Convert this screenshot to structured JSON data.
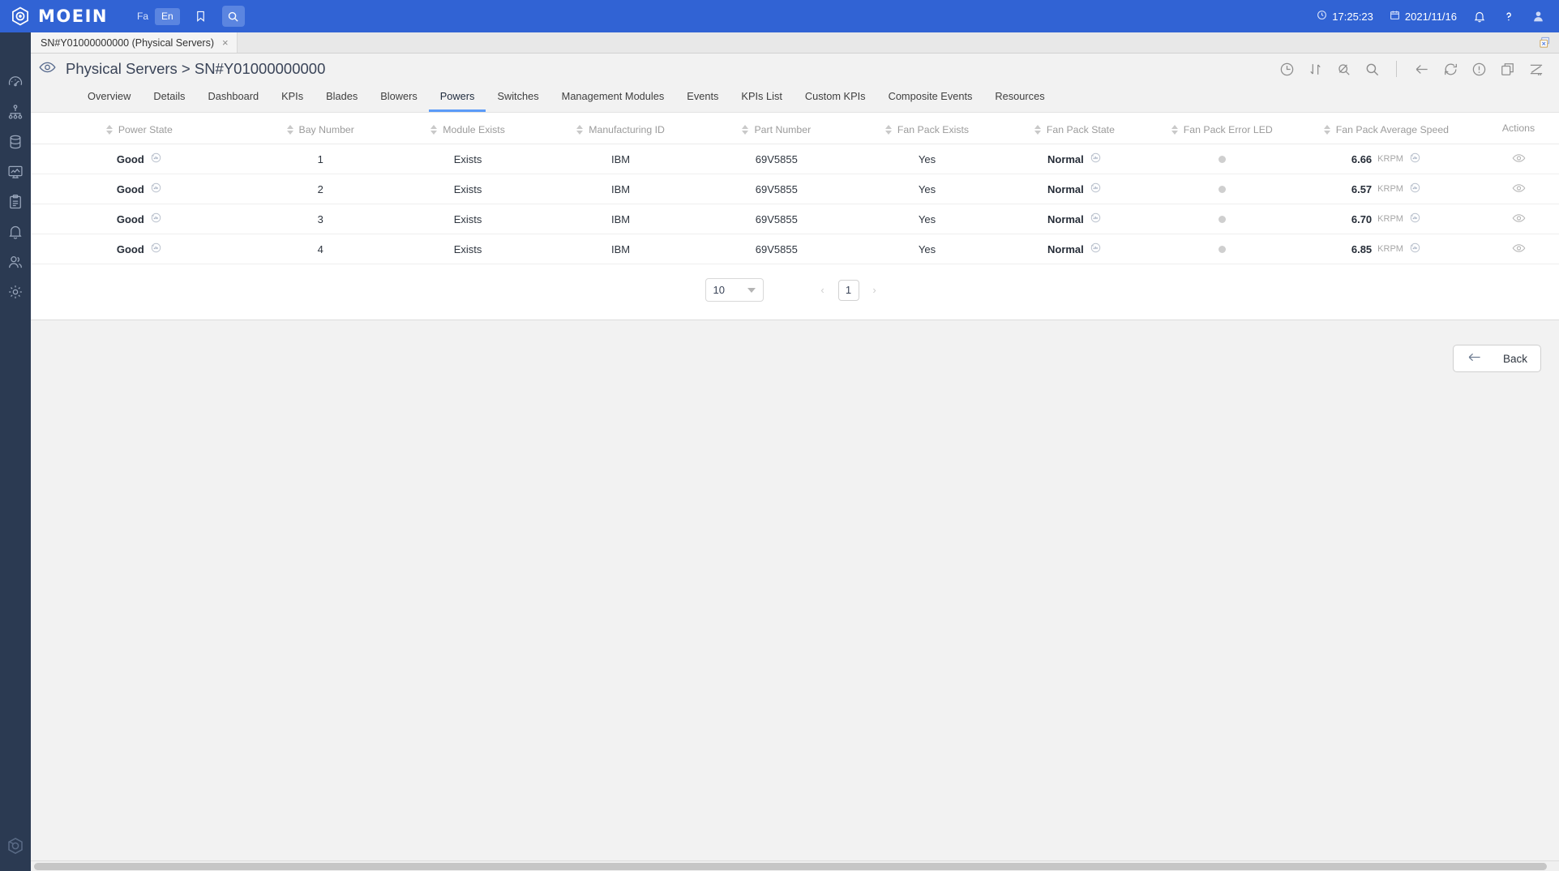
{
  "brand": {
    "name": "MOEIN",
    "logo_icon": "moein-logo-icon"
  },
  "header": {
    "lang_fa": "Fa",
    "lang_en": "En",
    "lang_active": "En",
    "bookmark_icon": "bookmark-icon",
    "search_icon": "search-icon",
    "time": "17:25:23",
    "date": "2021/11/16",
    "clock_icon": "clock-icon",
    "calendar_icon": "calendar-icon",
    "notifications_icon": "bell-icon",
    "help_icon": "question-mark-icon",
    "user_icon": "user-avatar-icon"
  },
  "tabstrip": {
    "tabs": [
      {
        "label": "SN#Y01000000000 (Physical Servers)",
        "close_glyph": "×",
        "active": true
      }
    ],
    "close_all_icon": "close-all-tabs-icon"
  },
  "sidebar": {
    "items": [
      {
        "name": "sidebar-item-monitoring",
        "icon": "gauge-icon"
      },
      {
        "name": "sidebar-item-topology",
        "icon": "hierarchy-icon"
      },
      {
        "name": "sidebar-item-inventory",
        "icon": "database-icon"
      },
      {
        "name": "sidebar-item-dashboards",
        "icon": "dashboard-chart-icon"
      },
      {
        "name": "sidebar-item-reports",
        "icon": "clipboard-icon"
      },
      {
        "name": "sidebar-item-alerts",
        "icon": "bell-icon"
      },
      {
        "name": "sidebar-item-users",
        "icon": "users-icon"
      },
      {
        "name": "sidebar-item-settings",
        "icon": "gear-icon"
      }
    ],
    "bottom_item": {
      "name": "sidebar-item-brand",
      "icon": "moein-mark-icon"
    }
  },
  "page": {
    "breadcrumb_icon": "eye-icon",
    "title": "Physical Servers > SN#Y01000000000",
    "tools": [
      {
        "name": "history-tool",
        "icon": "clock-history-icon"
      },
      {
        "name": "sort-tool",
        "icon": "sort-arrows-icon"
      },
      {
        "name": "clear-filter-tool",
        "icon": "search-off-icon"
      },
      {
        "name": "search-tool",
        "icon": "search-icon"
      },
      {
        "name": "separator",
        "icon": "divider"
      },
      {
        "name": "back-tool",
        "icon": "arrow-left-icon"
      },
      {
        "name": "refresh-tool",
        "icon": "refresh-icon"
      },
      {
        "name": "info-tool",
        "icon": "info-circle-icon"
      },
      {
        "name": "popout-tool",
        "icon": "open-in-new-icon"
      },
      {
        "name": "chart-tool",
        "icon": "trend-chart-icon"
      }
    ]
  },
  "navtabs": {
    "items": [
      {
        "label": "Overview",
        "active": false
      },
      {
        "label": "Details",
        "active": false
      },
      {
        "label": "Dashboard",
        "active": false
      },
      {
        "label": "KPIs",
        "active": false
      },
      {
        "label": "Blades",
        "active": false
      },
      {
        "label": "Blowers",
        "active": false
      },
      {
        "label": "Powers",
        "active": true
      },
      {
        "label": "Switches",
        "active": false
      },
      {
        "label": "Management Modules",
        "active": false
      },
      {
        "label": "Events",
        "active": false
      },
      {
        "label": "KPIs List",
        "active": false
      },
      {
        "label": "Custom KPIs",
        "active": false
      },
      {
        "label": "Composite Events",
        "active": false
      },
      {
        "label": "Resources",
        "active": false
      }
    ]
  },
  "table": {
    "columns": [
      {
        "label": "Power State",
        "sortable": true
      },
      {
        "label": "Bay Number",
        "sortable": true
      },
      {
        "label": "Module Exists",
        "sortable": true
      },
      {
        "label": "Manufacturing ID",
        "sortable": true
      },
      {
        "label": "Part Number",
        "sortable": true
      },
      {
        "label": "Fan Pack Exists",
        "sortable": true
      },
      {
        "label": "Fan Pack State",
        "sortable": true
      },
      {
        "label": "Fan Pack Error LED",
        "sortable": true
      },
      {
        "label": "Fan Pack Average Speed",
        "sortable": true
      },
      {
        "label": "Actions",
        "sortable": false
      }
    ],
    "rows": [
      {
        "power_state": "Good",
        "bay_number": "1",
        "module_exists": "Exists",
        "manufacturing_id": "IBM",
        "part_number": "69V5855",
        "fan_pack_exists": "Yes",
        "fan_pack_state": "Normal",
        "fan_pack_error_led": "off",
        "fan_pack_avg_speed": "6.66",
        "fan_pack_avg_speed_unit": "KRPM"
      },
      {
        "power_state": "Good",
        "bay_number": "2",
        "module_exists": "Exists",
        "manufacturing_id": "IBM",
        "part_number": "69V5855",
        "fan_pack_exists": "Yes",
        "fan_pack_state": "Normal",
        "fan_pack_error_led": "off",
        "fan_pack_avg_speed": "6.57",
        "fan_pack_avg_speed_unit": "KRPM"
      },
      {
        "power_state": "Good",
        "bay_number": "3",
        "module_exists": "Exists",
        "manufacturing_id": "IBM",
        "part_number": "69V5855",
        "fan_pack_exists": "Yes",
        "fan_pack_state": "Normal",
        "fan_pack_error_led": "off",
        "fan_pack_avg_speed": "6.70",
        "fan_pack_avg_speed_unit": "KRPM"
      },
      {
        "power_state": "Good",
        "bay_number": "4",
        "module_exists": "Exists",
        "manufacturing_id": "IBM",
        "part_number": "69V5855",
        "fan_pack_exists": "Yes",
        "fan_pack_state": "Normal",
        "fan_pack_error_led": "off",
        "fan_pack_avg_speed": "6.85",
        "fan_pack_avg_speed_unit": "KRPM"
      }
    ],
    "row_action_icon": "eye-icon",
    "metric_icon": "mini-chart-icon"
  },
  "pagination": {
    "page_size": "10",
    "prev_glyph": "‹",
    "next_glyph": "›",
    "current_page": "1"
  },
  "footer": {
    "back_label": "Back",
    "back_icon": "arrow-left-icon"
  },
  "colors": {
    "header_blue": "#3163d4",
    "sidebar_navy": "#2b3a52",
    "accent_blue": "#5b9bf8",
    "page_bg": "#f2f2f2",
    "led_off": "#cfcfcf"
  }
}
